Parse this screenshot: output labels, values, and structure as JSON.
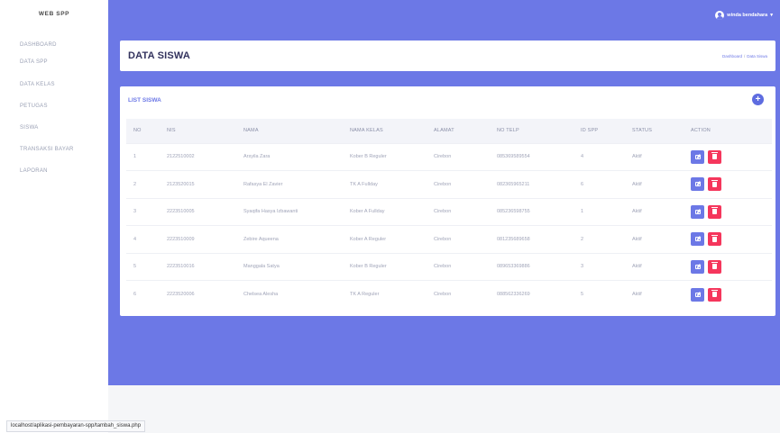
{
  "app": {
    "brand": "WEB SPP"
  },
  "sidebar": {
    "items": [
      {
        "label": "DASHBOARD"
      },
      {
        "label": "DATA SPP"
      },
      {
        "label": "DATA KELAS"
      },
      {
        "label": "PETUGAS"
      },
      {
        "label": "SISWA"
      },
      {
        "label": "TRANSAKSI BAYAR"
      },
      {
        "label": "LAPORAN"
      }
    ]
  },
  "topbar": {
    "user": "winda bendahara"
  },
  "header": {
    "title": "DATA SISWA",
    "breadcrumb": {
      "home": "Dashboard",
      "current": "Data Siswa"
    }
  },
  "list": {
    "title": "LIST SISWA",
    "add_label": "+",
    "columns": [
      "NO",
      "NIS",
      "NAMA",
      "NAMA KELAS",
      "ALAMAT",
      "NO TELP",
      "ID SPP",
      "STATUS",
      "ACTION"
    ],
    "rows": [
      {
        "no": "1",
        "nis": "2122510002",
        "nama": "Arsyila Zara",
        "kelas": "Kober B Reguler",
        "alamat": "Cirebon",
        "telp": "085369589554",
        "spp": "4",
        "status": "Aktif"
      },
      {
        "no": "2",
        "nis": "2123520015",
        "nama": "Rafasya El Zavier",
        "kelas": "TK A Fullday",
        "alamat": "Cirebon",
        "telp": "082365965211",
        "spp": "6",
        "status": "Aktif"
      },
      {
        "no": "3",
        "nis": "2223510005",
        "nama": "Syaqifa Hasya Izbawanti",
        "kelas": "Kober A Fullday",
        "alamat": "Cirebon",
        "telp": "085236598755",
        "spp": "1",
        "status": "Aktif"
      },
      {
        "no": "4",
        "nis": "2223510009",
        "nama": "Zebire Aqueena",
        "kelas": "Kober A Reguler",
        "alamat": "Cirebon",
        "telp": "081235689658",
        "spp": "2",
        "status": "Aktif"
      },
      {
        "no": "5",
        "nis": "2223510016",
        "nama": "Manggala Satya",
        "kelas": "Kober B Reguler",
        "alamat": "Cirebon",
        "telp": "089653369886",
        "spp": "3",
        "status": "Aktif"
      },
      {
        "no": "6",
        "nis": "2223520006",
        "nama": "Chelsea Alesha",
        "kelas": "TK A Reguler",
        "alamat": "Cirebon",
        "telp": "088562336269",
        "spp": "5",
        "status": "Aktif"
      }
    ]
  },
  "statusbar": {
    "url": "localhost/aplikasi-pembayaran-spp/tambah_siswa.php"
  },
  "colors": {
    "primary": "#6c78e6",
    "danger": "#f5365c",
    "sidebar_text": "#9aa0b4"
  }
}
